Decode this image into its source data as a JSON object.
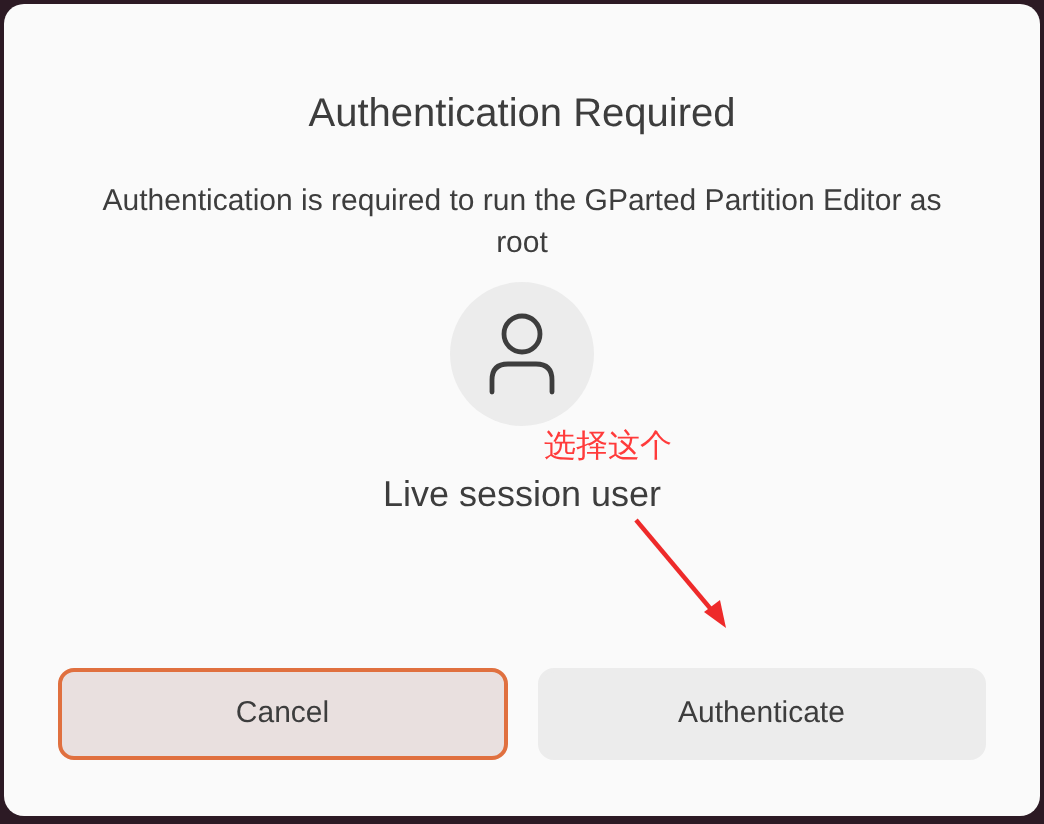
{
  "dialog": {
    "title": "Authentication Required",
    "message": "Authentication is required to run the GParted Partition Editor as root",
    "user": {
      "name": "Live session user"
    },
    "buttons": [
      {
        "label": "Cancel",
        "focused": true
      },
      {
        "label": "Authenticate",
        "focused": false
      }
    ]
  },
  "annotation": {
    "text": "选择这个"
  }
}
